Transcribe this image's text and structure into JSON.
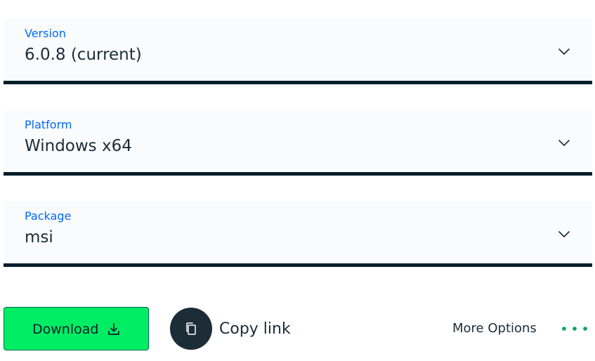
{
  "version": {
    "label": "Version",
    "value": "6.0.8 (current)",
    "icon": "chevron-down-icon"
  },
  "platform": {
    "label": "Platform",
    "value": "Windows x64",
    "icon": "chevron-down-icon"
  },
  "package": {
    "label": "Package",
    "value": "msi",
    "icon": "chevron-down-icon"
  },
  "actions": {
    "download_label": "Download",
    "download_icon": "download-icon",
    "copy_link_label": "Copy link",
    "copy_icon": "copy-icon",
    "more_options_label": "More Options",
    "more_icon": "ellipsis-icon"
  },
  "colors": {
    "accent_blue": "#016bf8",
    "download_green": "#00ed64",
    "download_border": "#00684a",
    "dark": "#001e2b",
    "text": "#1c2d38",
    "field_bg": "#f9fbfc"
  }
}
